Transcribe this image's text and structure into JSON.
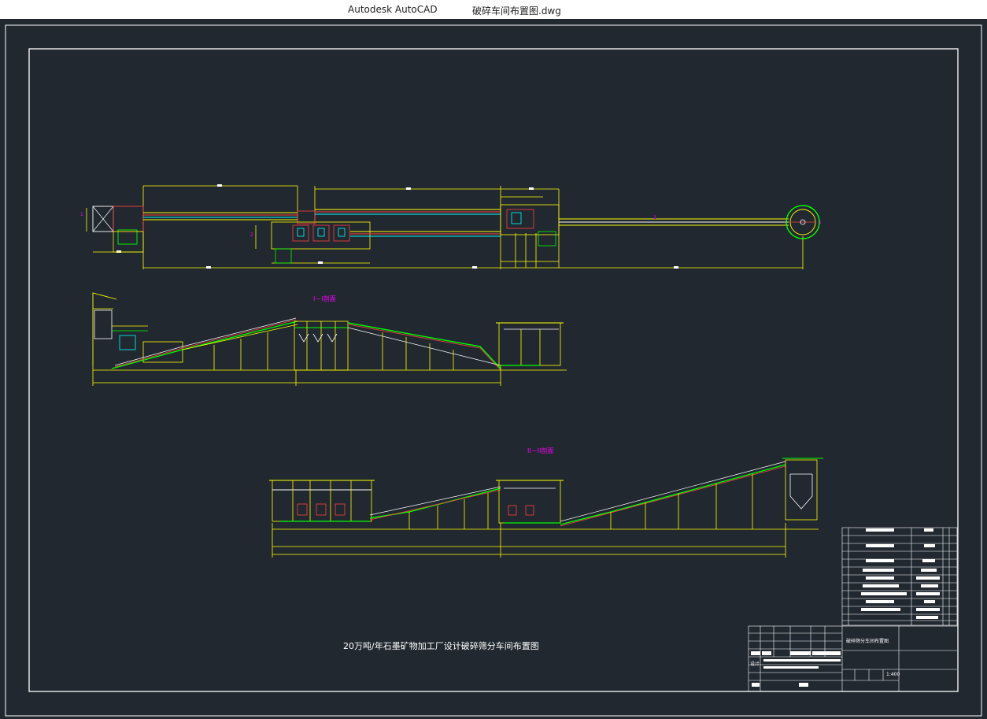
{
  "window": {
    "app_title": "Autodesk AutoCAD",
    "document_title": "破碎车间布置图.dwg"
  },
  "drawing": {
    "main_title": "20万吨/年石墨矿物加工厂设计破碎筛分车间布置图",
    "section_1_label": "I－I剖面",
    "section_2_label": "II－II剖面",
    "title_block": {
      "drawing_name": "破碎筛分车间布置图",
      "scale": "1:400",
      "designer_label": "设计"
    },
    "colors": {
      "background": "#212830",
      "frame": "#ffffff",
      "structure": "#ffff00",
      "conveyor": "#00ff00",
      "belt_accent": "#ff4040",
      "equipment": "#00ffff",
      "section_label": "#ff00ff"
    }
  }
}
